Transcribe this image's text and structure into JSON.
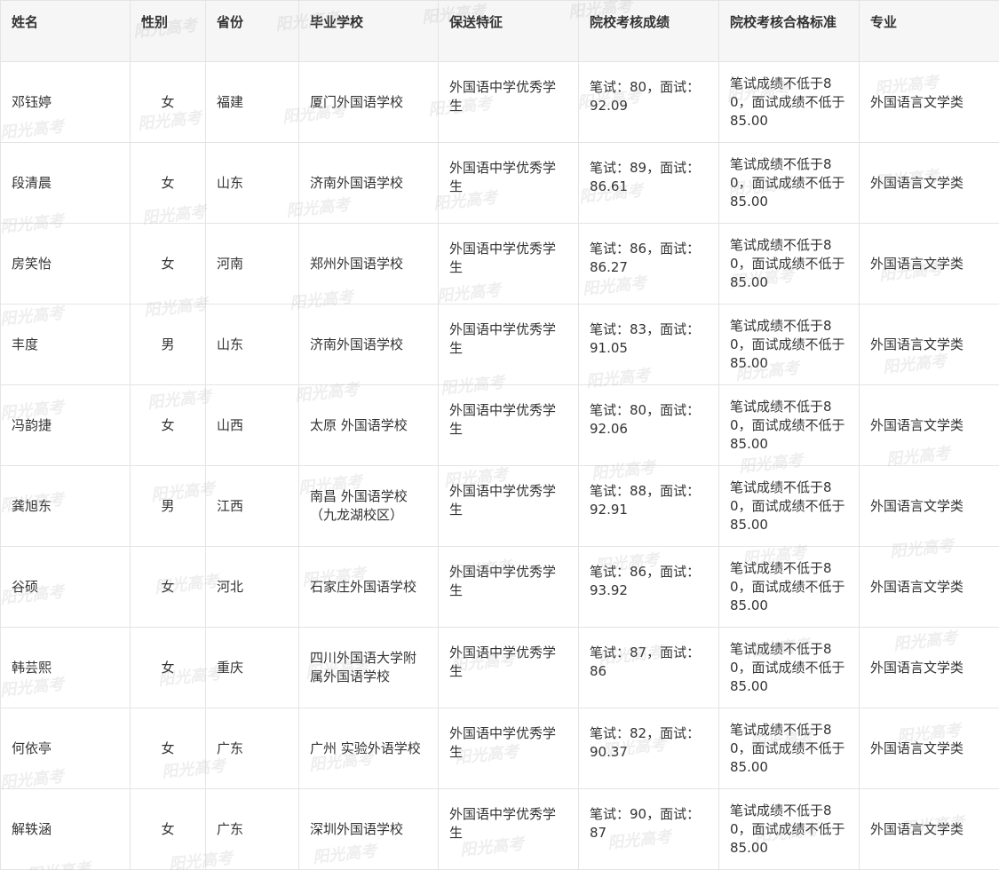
{
  "table": {
    "headers": [
      "姓名",
      "性别",
      "省份",
      "毕业学校",
      "保送特征",
      "院校考核成绩",
      "院校考核合格标准",
      "专业"
    ],
    "rows": [
      [
        "邓钰婷",
        "女",
        "福建",
        "厦门外国语学校",
        "外国语中学优秀学生",
        "笔试：80，面试：92.09",
        "笔试成绩不低于80，面试成绩不低于85.00",
        "外国语言文学类"
      ],
      [
        "段清晨",
        "女",
        "山东",
        "济南外国语学校",
        "外国语中学优秀学生",
        "笔试：89，面试：86.61",
        "笔试成绩不低于80，面试成绩不低于85.00",
        "外国语言文学类"
      ],
      [
        "房笑怡",
        "女",
        "河南",
        "郑州外国语学校",
        "外国语中学优秀学生",
        "笔试：86，面试：86.27",
        "笔试成绩不低于80，面试成绩不低于85.00",
        "外国语言文学类"
      ],
      [
        "丰度",
        "男",
        "山东",
        "济南外国语学校",
        "外国语中学优秀学生",
        "笔试：83，面试：91.05",
        "笔试成绩不低于80，面试成绩不低于85.00",
        "外国语言文学类"
      ],
      [
        "冯韵捷",
        "女",
        "山西",
        "太原 外国语学校",
        "外国语中学优秀学生",
        "笔试：80，面试：92.06",
        "笔试成绩不低于80，面试成绩不低于85.00",
        "外国语言文学类"
      ],
      [
        "龚旭东",
        "男",
        "江西",
        "南昌 外国语学校（九龙湖校区）",
        "外国语中学优秀学生",
        "笔试：88，面试：92.91",
        "笔试成绩不低于80，面试成绩不低于85.00",
        "外国语言文学类"
      ],
      [
        "谷硕",
        "女",
        "河北",
        "石家庄外国语学校",
        "外国语中学优秀学生",
        "笔试：86，面试：93.92",
        "笔试成绩不低于80，面试成绩不低于85.00",
        "外国语言文学类"
      ],
      [
        "韩芸熙",
        "女",
        "重庆",
        "四川外国语大学附属外国语学校",
        "外国语中学优秀学生",
        "笔试：87，面试：86",
        "笔试成绩不低于80，面试成绩不低于85.00",
        "外国语言文学类"
      ],
      [
        "何依亭",
        "女",
        "广东",
        "广州 实验外语学校",
        "外国语中学优秀学生",
        "笔试：82，面试：90.37",
        "笔试成绩不低于80，面试成绩不低于85.00",
        "外国语言文学类"
      ],
      [
        "解轶涵",
        "女",
        "广东",
        "深圳外国语学校",
        "外国语中学优秀学生",
        "笔试：90，面试：87",
        "笔试成绩不低于80，面试成绩不低于85.00",
        "外国语言文学类"
      ]
    ]
  },
  "watermark": {
    "text": "阳光高考"
  }
}
